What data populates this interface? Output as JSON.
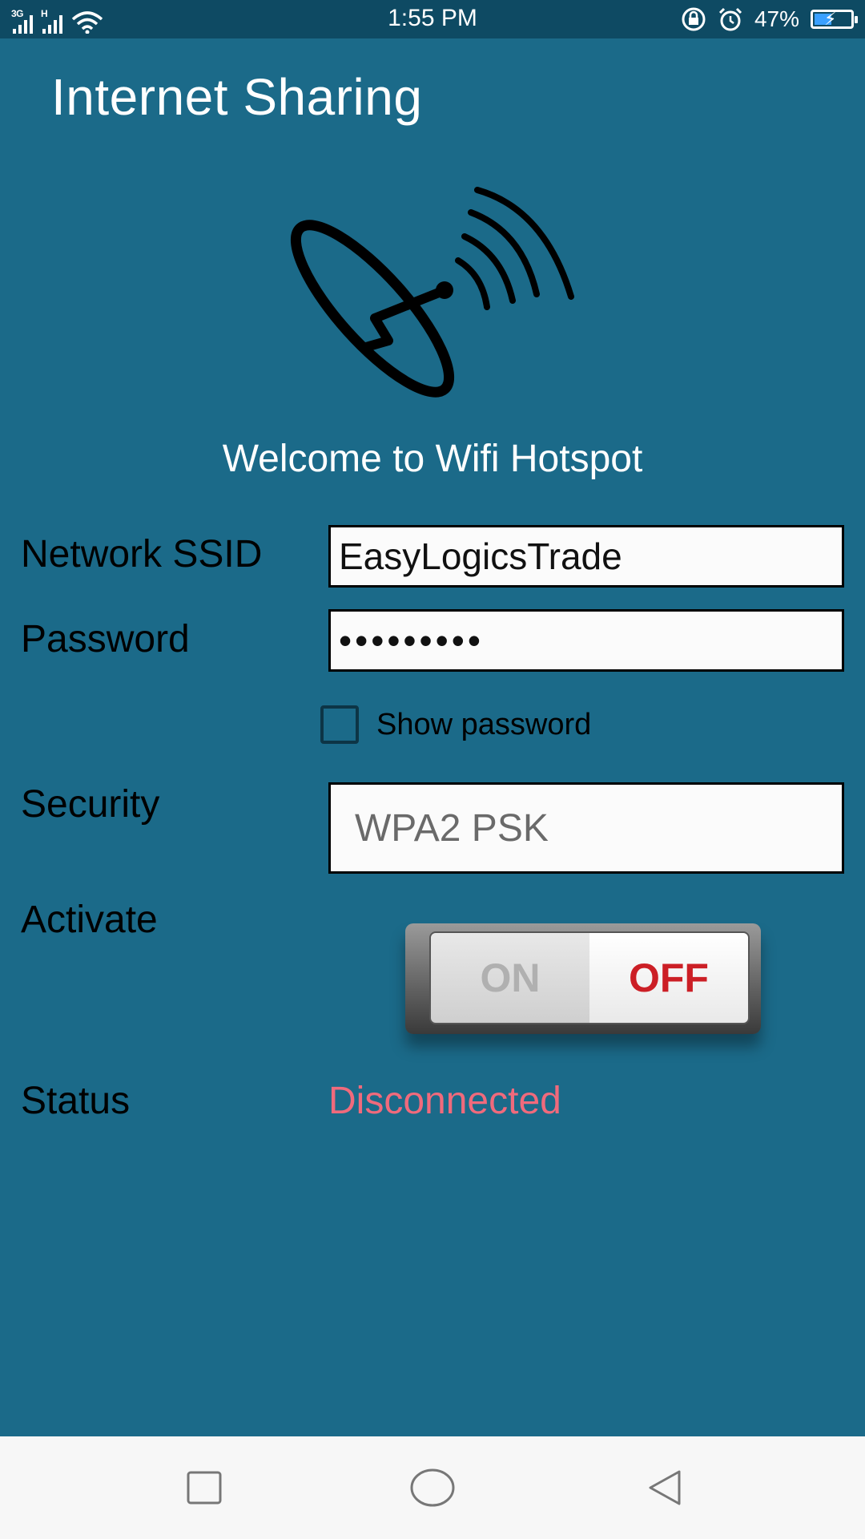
{
  "status_bar": {
    "network_1": "3G",
    "network_2": "H",
    "time": "1:55 PM",
    "battery_percent": "47%",
    "battery_level": 0.47,
    "icons": [
      "signal-icon",
      "wifi-icon",
      "screen-rotation-lock-icon",
      "alarm-icon",
      "battery-charging-icon"
    ]
  },
  "app": {
    "title": "Internet Sharing",
    "logo_icon": "satellite-dish-icon",
    "welcome": "Welcome to Wifi Hotspot"
  },
  "form": {
    "ssid_label": "Network SSID",
    "ssid_value": "EasyLogicsTrade",
    "password_label": "Password",
    "password_value": "•••••••••",
    "show_password_label": "Show password",
    "show_password_checked": false,
    "security_label": "Security",
    "security_value": "WPA2 PSK",
    "activate_label": "Activate",
    "toggle_on": "ON",
    "toggle_off": "OFF",
    "toggle_state": "OFF",
    "status_label": "Status",
    "status_value": "Disconnected"
  },
  "colors": {
    "background": "#1b6a89",
    "status_bar": "#0e4a63",
    "status_disconnected": "#f06a7c",
    "toggle_off_text": "#cc1f26"
  },
  "nav_bar": {
    "buttons": [
      "recent-apps-icon",
      "home-icon",
      "back-icon"
    ]
  }
}
